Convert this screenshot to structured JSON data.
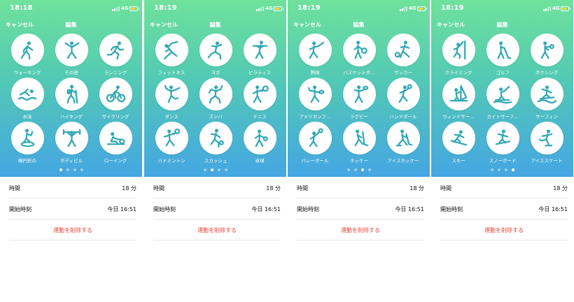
{
  "panels": [
    {
      "status": {
        "time": "18:18",
        "network": "4G"
      },
      "nav": {
        "cancel": "キャンセル",
        "edit": "編集"
      },
      "activities": [
        {
          "label": "ウォーキング",
          "icon": "walking-icon"
        },
        {
          "label": "その他",
          "icon": "other-workout-icon"
        },
        {
          "label": "ランニング",
          "icon": "running-icon"
        },
        {
          "label": "水泳",
          "icon": "swimming-icon"
        },
        {
          "label": "ハイキング",
          "icon": "hiking-icon"
        },
        {
          "label": "サイクリング",
          "icon": "cycling-icon"
        },
        {
          "label": "楕円形の",
          "icon": "elliptical-icon"
        },
        {
          "label": "ボディビル",
          "icon": "bodybuilding-icon"
        },
        {
          "label": "ローイング",
          "icon": "rowing-icon"
        }
      ],
      "page_index": 0
    },
    {
      "status": {
        "time": "18:19",
        "network": "4G"
      },
      "nav": {
        "cancel": "キャンセル",
        "edit": "編集"
      },
      "activities": [
        {
          "label": "フィットネス",
          "icon": "fitness-icon"
        },
        {
          "label": "ヨガ",
          "icon": "yoga-icon"
        },
        {
          "label": "ピラティス",
          "icon": "pilates-icon"
        },
        {
          "label": "ダンス",
          "icon": "dance-icon"
        },
        {
          "label": "ズンバ",
          "icon": "zumba-icon"
        },
        {
          "label": "テニス",
          "icon": "tennis-icon"
        },
        {
          "label": "バドミントン",
          "icon": "badminton-icon"
        },
        {
          "label": "スカッシュ",
          "icon": "squash-icon"
        },
        {
          "label": "卓球",
          "icon": "table-tennis-icon"
        }
      ],
      "page_index": 1
    },
    {
      "status": {
        "time": "18:19",
        "network": "4G"
      },
      "nav": {
        "cancel": "キャンセル",
        "edit": "編集"
      },
      "activities": [
        {
          "label": "野球",
          "icon": "baseball-icon"
        },
        {
          "label": "バスケットボ…",
          "icon": "basketball-icon"
        },
        {
          "label": "サッカー",
          "icon": "soccer-icon"
        },
        {
          "label": "アメリカンフ…",
          "icon": "american-football-icon"
        },
        {
          "label": "ラグビー",
          "icon": "rugby-icon"
        },
        {
          "label": "ハンドボール",
          "icon": "handball-icon"
        },
        {
          "label": "バレーボール",
          "icon": "volleyball-icon"
        },
        {
          "label": "ホッケー",
          "icon": "hockey-icon"
        },
        {
          "label": "アイスホッケー",
          "icon": "ice-hockey-icon"
        }
      ],
      "page_index": 2
    },
    {
      "status": {
        "time": "18:19",
        "network": "4G"
      },
      "nav": {
        "cancel": "キャンセル",
        "edit": "編集"
      },
      "activities": [
        {
          "label": "クライミング",
          "icon": "climbing-icon"
        },
        {
          "label": "ゴルフ",
          "icon": "golf-icon"
        },
        {
          "label": "ボクシング",
          "icon": "boxing-icon"
        },
        {
          "label": "ウィンドサー…",
          "icon": "windsurfing-icon"
        },
        {
          "label": "カイトサーフ…",
          "icon": "kitesurfing-icon"
        },
        {
          "label": "サーフィン",
          "icon": "surfing-icon"
        },
        {
          "label": "スキー",
          "icon": "skiing-icon"
        },
        {
          "label": "スノーボード",
          "icon": "snowboarding-icon"
        },
        {
          "label": "アイススケート",
          "icon": "ice-skating-icon"
        }
      ],
      "page_index": 3
    }
  ],
  "page_count": 4,
  "details": {
    "duration_label": "時間",
    "duration_value": "18 分",
    "start_label": "開始時刻",
    "start_value": "今日 16:51",
    "delete_label": "運動を削除する"
  },
  "colors": {
    "gradient_top": "#6fe29c",
    "gradient_bottom": "#45a6e3",
    "icon": "#2fa8b5",
    "delete": "#e8453c"
  }
}
